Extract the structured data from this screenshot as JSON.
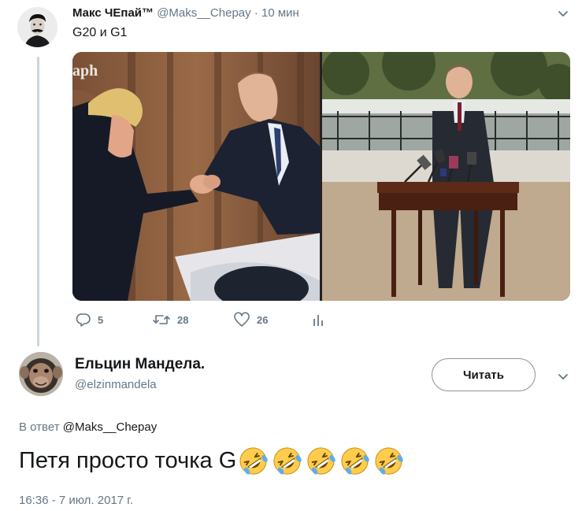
{
  "tweet1": {
    "author_name": "Макс ЧЕпай™",
    "author_handle": "@Maks__Chepay",
    "time_separator": "·",
    "time": "10 мин",
    "text": "G20 и G1",
    "left_photo_watermark": "aph",
    "actions": {
      "reply_count": "5",
      "retweet_count": "28",
      "like_count": "26"
    },
    "icons": [
      "reply-icon",
      "retweet-icon",
      "like-icon",
      "analytics-icon",
      "chevron-down-icon"
    ]
  },
  "tweet2": {
    "author_name": "Ельцин Мандела.",
    "author_handle": "@elzinmandela",
    "follow_label": "Читать",
    "reply_prefix": "В ответ",
    "reply_mention": "@Maks__Chepay",
    "text": "Петя просто точка G",
    "emoji_count": 5,
    "emoji_name": "rolling-on-the-floor-laughing",
    "timestamp": "16:36 - 7 июл. 2017 г."
  },
  "colors": {
    "text_primary": "#14171a",
    "text_secondary": "#657786",
    "thread_line": "#ccd6dd",
    "button_border": "#8c9196",
    "emoji_yellow": "#ffcc4d"
  }
}
